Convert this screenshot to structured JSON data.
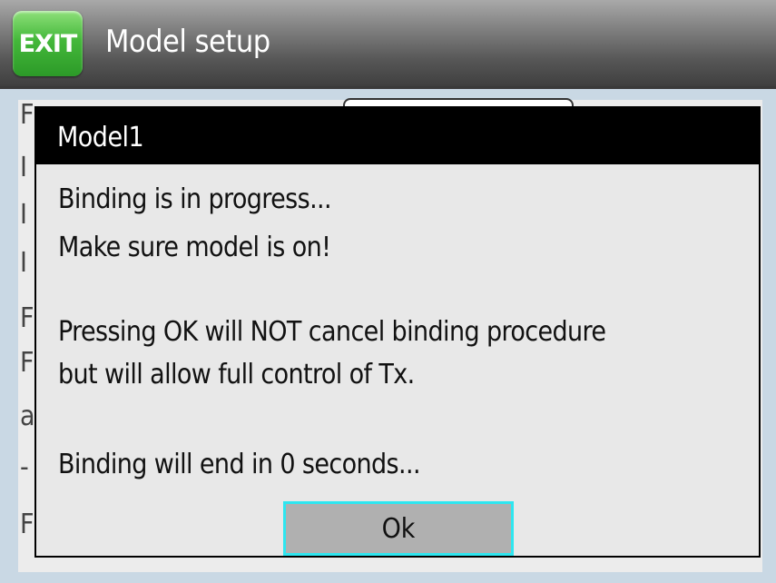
{
  "header": {
    "exit_label": "EXIT",
    "title": "Model setup"
  },
  "background": {
    "row_initials": [
      "F",
      "I",
      "I",
      "I",
      "F",
      "F",
      "a",
      "-",
      "F"
    ]
  },
  "dialog": {
    "title": "Model1",
    "lines": [
      "Binding is in progress...",
      "Make sure model is on!",
      "Pressing OK will NOT cancel binding procedure",
      "but will allow full control of Tx.",
      "Binding will end in 0 seconds..."
    ],
    "ok_label": "Ok"
  },
  "colors": {
    "exit_button": "#44b83a",
    "ok_focus_border": "#2ee6f0",
    "screen_background": "#c9d8e4"
  }
}
